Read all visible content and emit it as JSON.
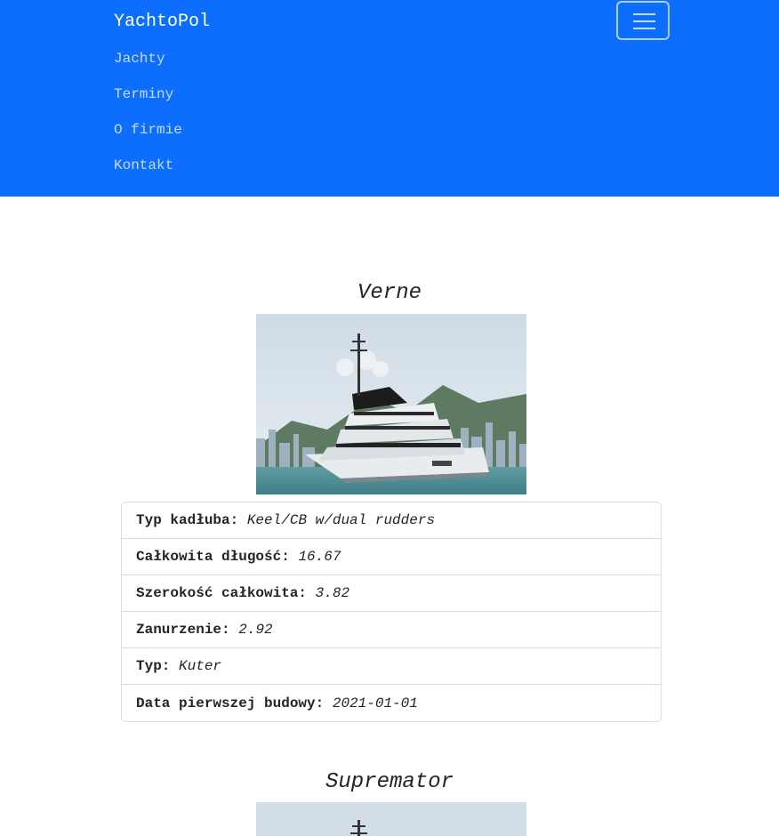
{
  "navbar": {
    "brand": "YachtoPol",
    "links": [
      "Jachty",
      "Terminy",
      "O firmie",
      "Kontakt"
    ],
    "toggler_icon": "hamburger-menu-icon",
    "bg_color": "#0d6efd"
  },
  "yachts": [
    {
      "name": "Verne",
      "photo": "yacht-photo",
      "specs": [
        {
          "label": "Typ kadłuba:",
          "value": "Keel/CB w/dual rudders"
        },
        {
          "label": "Całkowita długość:",
          "value": "16.67"
        },
        {
          "label": "Szerokość całkowita:",
          "value": "3.82"
        },
        {
          "label": "Zanurzenie:",
          "value": "2.92"
        },
        {
          "label": "Typ:",
          "value": "Kuter"
        },
        {
          "label": "Data pierwszej budowy:",
          "value": "2021-01-01"
        }
      ]
    },
    {
      "name": "Supremator",
      "photo": "yacht-photo"
    }
  ]
}
